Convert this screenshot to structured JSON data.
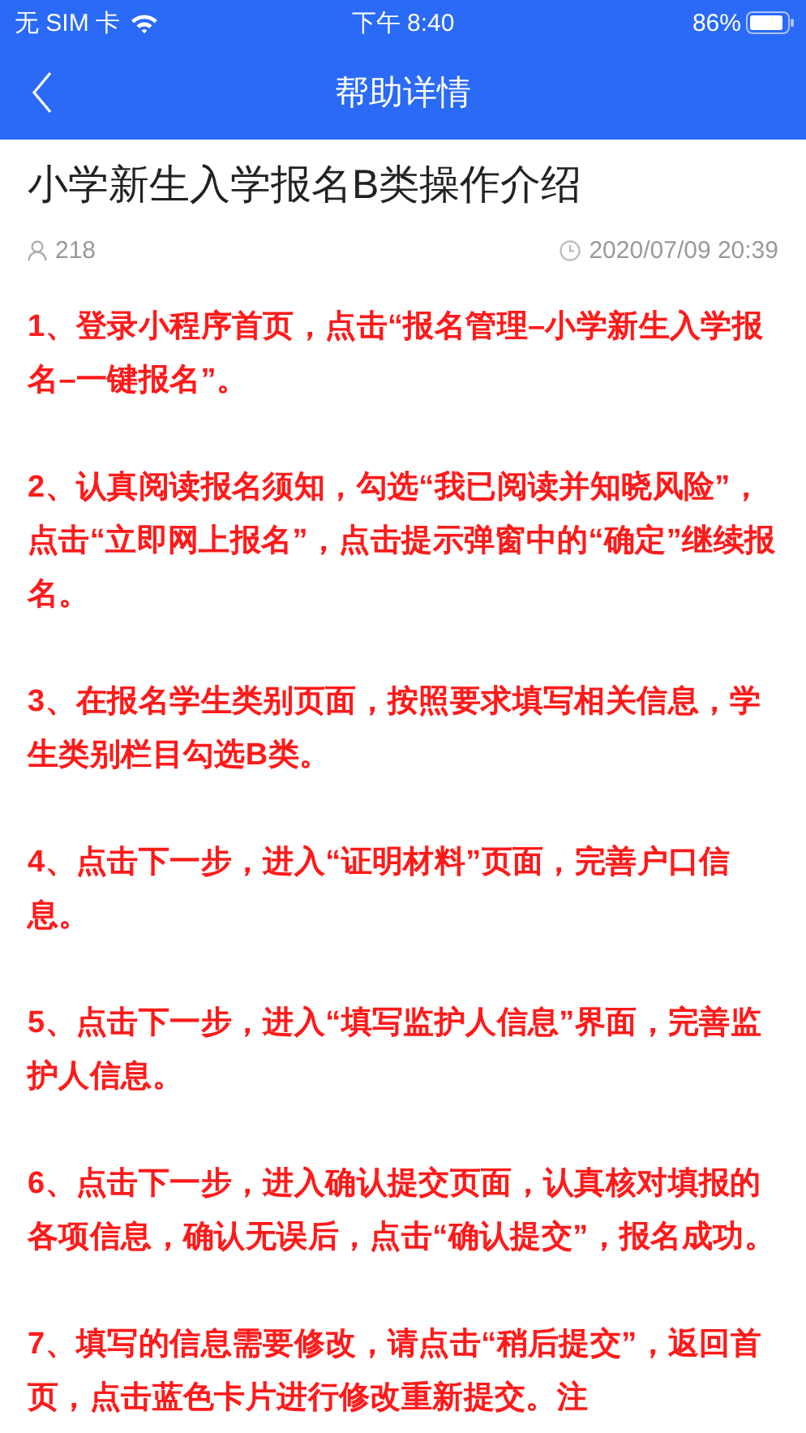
{
  "status_bar": {
    "carrier": "无 SIM 卡",
    "time": "下午 8:40",
    "battery": "86%"
  },
  "nav": {
    "title": "帮助详情"
  },
  "article": {
    "title": "小学新生入学报名B类操作介绍",
    "views": "218",
    "date": "2020/07/09 20:39",
    "paragraphs": [
      "1、登录小程序首页，点击“报名管理–小学新生入学报名–一键报名”。",
      "2、认真阅读报名须知，勾选“我已阅读并知晓风险”，点击“立即网上报名”，点击提示弹窗中的“确定”继续报名。",
      "3、在报名学生类别页面，按照要求填写相关信息，学生类别栏目勾选B类。",
      "4、点击下一步，进入“证明材料”页面，完善户口信息。",
      "5、点击下一步，进入“填写监护人信息”界面，完善监护人信息。",
      "6、点击下一步，进入确认提交页面，认真核对填报的各项信息，确认无误后，点击“确认提交”，报名成功。",
      "7、填写的信息需要修改，请点击“稍后提交”，返回首页，点击蓝色卡片进行修改重新提交。注"
    ]
  }
}
